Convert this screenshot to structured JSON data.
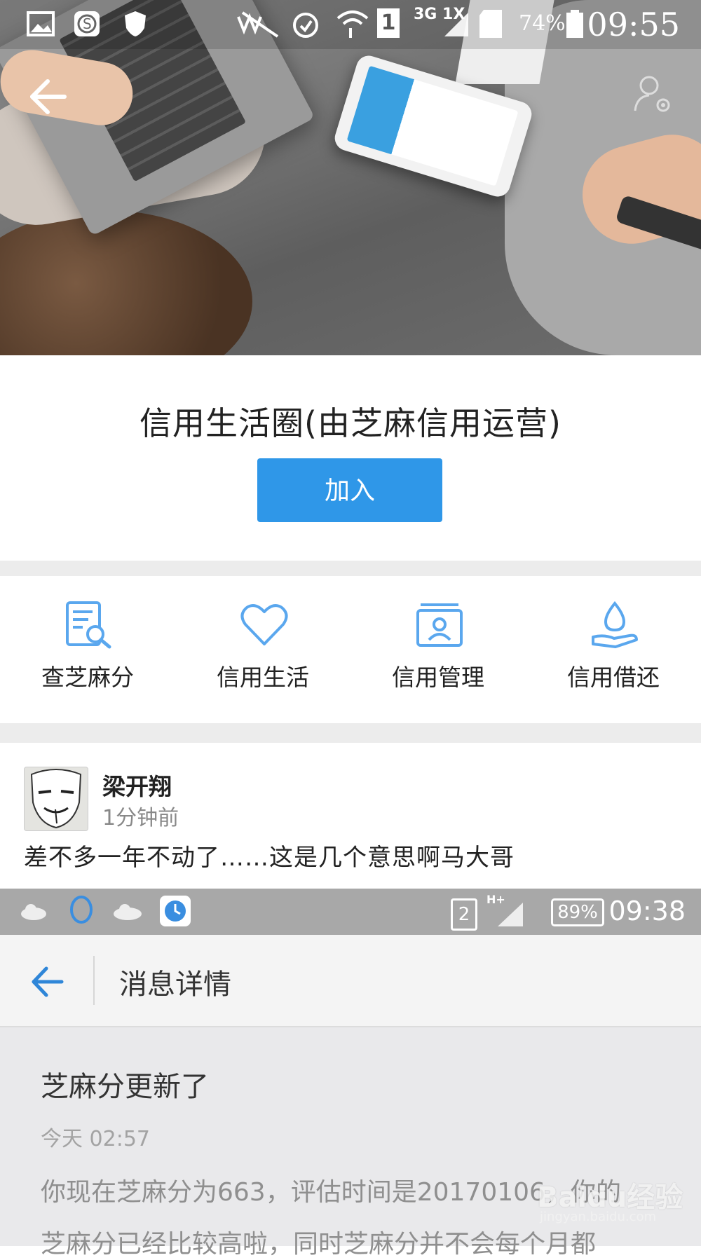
{
  "status_bar": {
    "time": "09:55",
    "battery": "74%",
    "network": "3G 1X",
    "sim_slot": "1",
    "icons": [
      "gallery-icon",
      "s-app-icon",
      "shield-icon",
      "mute-icon",
      "alarm-icon",
      "wifi-icon",
      "signal-icon",
      "sd-card-icon",
      "battery-icon"
    ]
  },
  "nav": {
    "back_icon": "back-arrow-icon",
    "user_icon": "user-settings-icon"
  },
  "circle": {
    "title": "信用生活圈(由芝麻信用运营)",
    "join_label": "加入"
  },
  "quick_menu": [
    {
      "label": "查芝麻分",
      "icon": "document-search-icon"
    },
    {
      "label": "信用生活",
      "icon": "heart-icon"
    },
    {
      "label": "信用管理",
      "icon": "id-card-icon"
    },
    {
      "label": "信用借还",
      "icon": "hand-drop-icon"
    }
  ],
  "post": {
    "author": "梁开翔",
    "time": "1分钟前",
    "text": "差不多一年不动了……这是几个意思啊马大哥",
    "embedded_screenshot": {
      "status": {
        "time": "09:38",
        "battery": "89%",
        "sim": "2",
        "network": "H+"
      },
      "header_title": "消息详情",
      "message_title": "芝麻分更新了",
      "message_time": "今天 02:57",
      "message_body_line1": "你现在芝麻分为663，评估时间是20170106，你的",
      "message_body_line2": "芝麻分已经比较高啦，同时芝麻分并不会每个月都"
    }
  },
  "watermark": {
    "brand": "Baidu经验",
    "url": "jingyan.baidu.com"
  },
  "colors": {
    "accent": "#2f97e8",
    "icon_blue": "#5aa7ee",
    "divider": "#ececec"
  }
}
